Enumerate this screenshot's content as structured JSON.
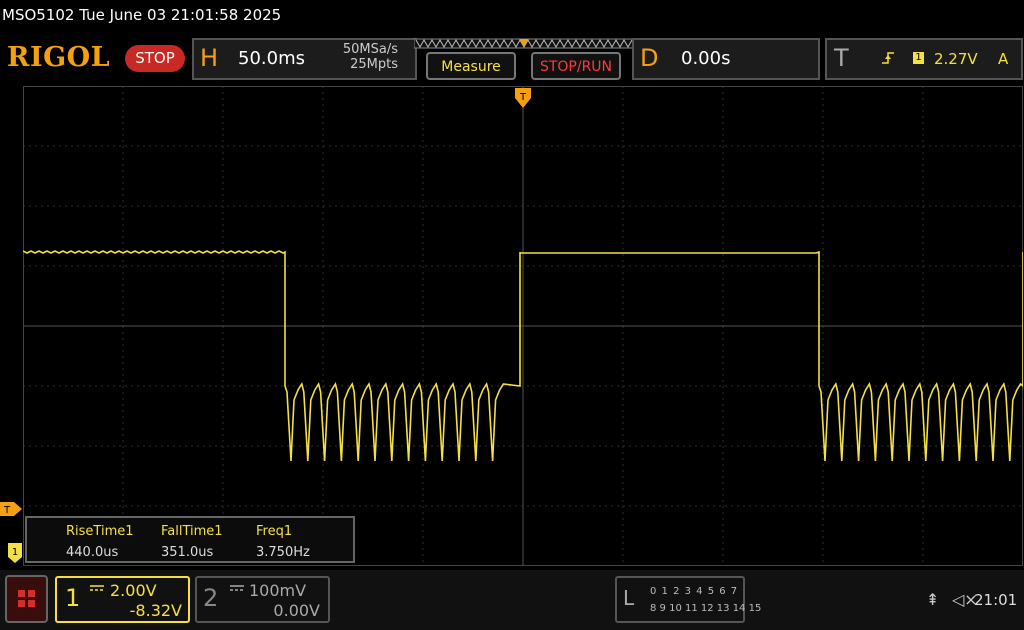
{
  "header": {
    "title": "MSO5102  Tue June 03 21:01:58 2025",
    "brand": "RIGOL",
    "run_state": "STOP"
  },
  "horizontal": {
    "letter": "H",
    "timebase": "50.0ms",
    "sample_rate": "50MSa/s",
    "memory_depth": "25Mpts"
  },
  "buttons": {
    "measure": "Measure",
    "stop_run": "STOP/RUN"
  },
  "delay": {
    "letter": "D",
    "value": "0.00s"
  },
  "trigger": {
    "letter": "T",
    "source": "1",
    "level": "2.27V",
    "mode": "A",
    "position_marker": "T",
    "edge_icon": "rising-edge-icon"
  },
  "measurements": [
    {
      "label": "RiseTime1",
      "value": "440.0us"
    },
    {
      "label": "FallTime1",
      "value": "351.0us"
    },
    {
      "label": "Freq1",
      "value": "3.750Hz"
    }
  ],
  "channels": [
    {
      "number": "1",
      "scale": "2.00V",
      "offset": "-8.32V",
      "active": true,
      "color": "#f5e042"
    },
    {
      "number": "2",
      "scale": "100mV",
      "offset": "0.00V",
      "active": false,
      "color": "#888888"
    }
  ],
  "logic_analyzer": {
    "letter": "L",
    "row1": "0 1 2 3  4 5 6 7",
    "row2": "8 9 10 11 12 13 14 15"
  },
  "status": {
    "clock": "21:01",
    "usb_icon": "usb-icon",
    "speaker_icon": "speaker-muted-icon"
  },
  "colors": {
    "brand": "#f5a011",
    "ch1": "#f5e042",
    "stop": "#c62a22",
    "grid": "#3a3a3a"
  },
  "waveform": {
    "description_free_fields": true,
    "period_divisions": 5.35,
    "high_level_div": 1.3,
    "low_level_div": -1.0
  }
}
